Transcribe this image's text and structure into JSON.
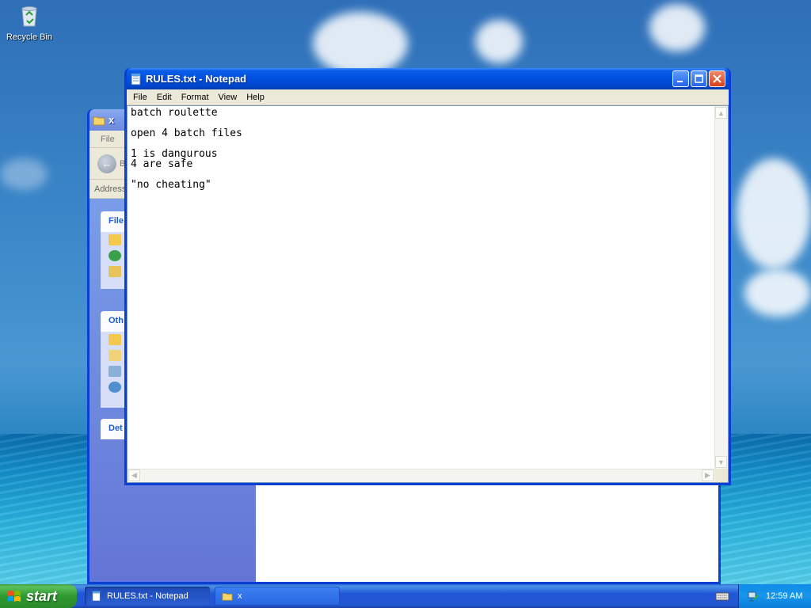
{
  "desktop": {
    "icons": [
      {
        "name": "recycle-bin",
        "label": "Recycle Bin"
      }
    ]
  },
  "explorer": {
    "title": "x",
    "menu": [
      "File"
    ],
    "back_label": "B",
    "address_label": "Address",
    "panels": [
      {
        "header": "File"
      },
      {
        "header": "Oth"
      },
      {
        "header": "Det"
      }
    ]
  },
  "notepad": {
    "title": "RULES.txt - Notepad",
    "menu": [
      "File",
      "Edit",
      "Format",
      "View",
      "Help"
    ],
    "content": "batch roulette\n\nopen 4 batch files\n\n1 is dangurous\n4 are safe\n\n\"no cheating\""
  },
  "taskbar": {
    "start_label": "start",
    "tasks": [
      {
        "label": "RULES.txt - Notepad",
        "active": true
      },
      {
        "label": "x",
        "active": false
      }
    ],
    "clock": "12:59 AM"
  }
}
